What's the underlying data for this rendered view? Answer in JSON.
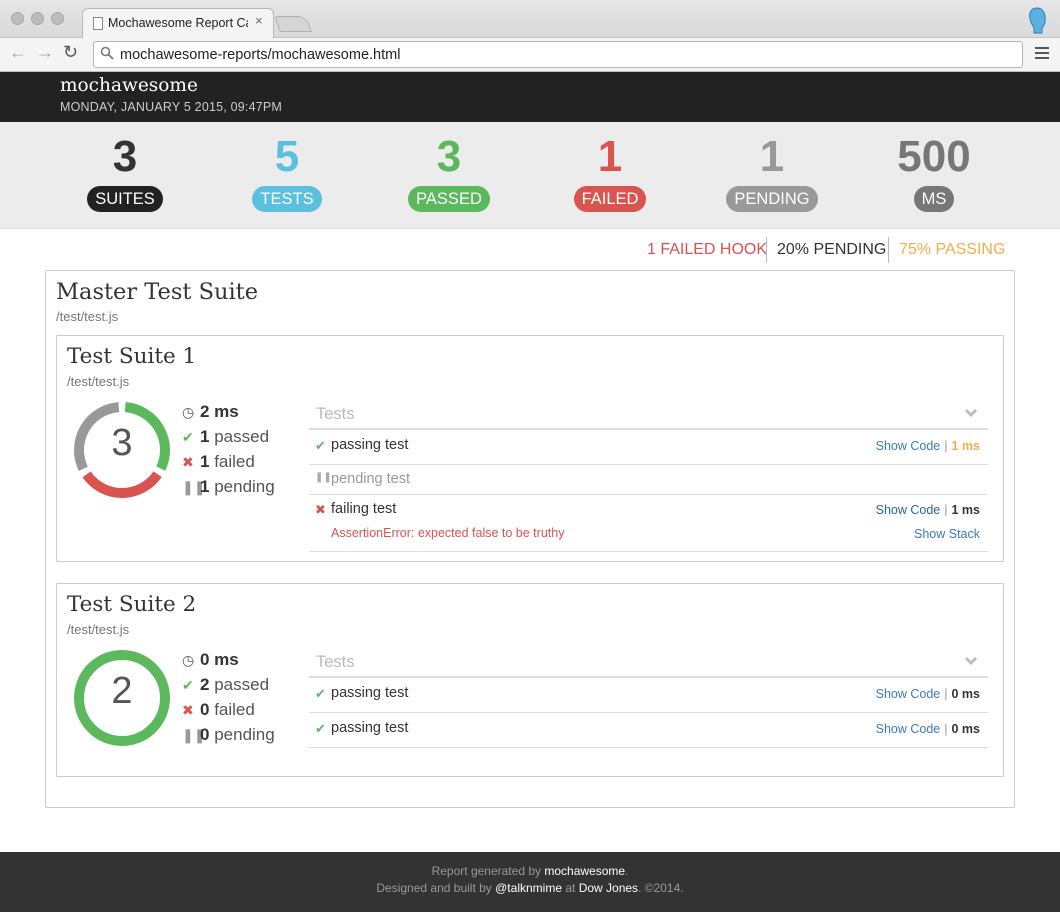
{
  "browser": {
    "tab_title": "Mochawesome Report Card",
    "tab_close": "×",
    "url": "mochawesome-reports/mochawesome.html",
    "back_glyph": "←",
    "forward_glyph": "→",
    "reload_glyph": "↻",
    "icons": {
      "doc": "document-icon",
      "search": "search-icon",
      "menu": "hamburger-menu-icon",
      "profile": "profile-icon"
    }
  },
  "header": {
    "brand": "mochawesome",
    "date": "MONDAY, JANUARY 5 2015, 09:47PM"
  },
  "summary": {
    "stats": [
      {
        "value": "3",
        "label": "SUITES",
        "color": "#222222"
      },
      {
        "value": "5",
        "label": "TESTS",
        "color": "#5bc0de"
      },
      {
        "value": "3",
        "label": "PASSED",
        "color": "#5cb85c"
      },
      {
        "value": "1",
        "label": "FAILED",
        "color": "#d9534f"
      },
      {
        "value": "1",
        "label": "PENDING",
        "color": "#999999"
      },
      {
        "value": "500",
        "label": "MS",
        "color": "#777777"
      }
    ],
    "quick": {
      "failed_hook": "1 FAILED HOOK",
      "pending": "20% PENDING",
      "passing": "75% PASSING"
    }
  },
  "master": {
    "title": "Master Test Suite",
    "path": "/test/test.js"
  },
  "suites": [
    {
      "title": "Test Suite 1",
      "path": "/test/test.js",
      "total": "3",
      "passed_fraction": 0.333,
      "failed_fraction": 0.333,
      "pending_fraction": 0.334,
      "duration": "2 ms",
      "passed": "1",
      "passed_label": "passed",
      "failed": "1",
      "failed_label": "failed",
      "pending": "1",
      "pending_label": "pending",
      "tests_label": "Tests",
      "tests": [
        {
          "name": "passing test",
          "status": "passed",
          "show_code": "Show Code",
          "pipe": "|",
          "duration": "1 ms"
        },
        {
          "name": "pending test",
          "status": "pending"
        },
        {
          "name": "failing test",
          "status": "failed",
          "show_code": "Show Code",
          "pipe": "|",
          "duration": "1 ms",
          "error": "AssertionError: expected false to be truthy",
          "show_stack": "Show Stack"
        }
      ]
    },
    {
      "title": "Test Suite 2",
      "path": "/test/test.js",
      "total": "2",
      "passed_fraction": 1.0,
      "failed_fraction": 0,
      "pending_fraction": 0,
      "duration": "0 ms",
      "passed": "2",
      "passed_label": "passed",
      "failed": "0",
      "failed_label": "failed",
      "pending": "0",
      "pending_label": "pending",
      "tests_label": "Tests",
      "tests": [
        {
          "name": "passing test",
          "status": "passed",
          "show_code": "Show Code",
          "pipe": "|",
          "duration": "0 ms"
        },
        {
          "name": "passing test",
          "status": "passed",
          "show_code": "Show Code",
          "pipe": "|",
          "duration": "0 ms"
        }
      ]
    }
  ],
  "footer": {
    "line1_prefix": "Report generated by ",
    "line1_link": "mochawesome",
    "line1_suffix": ".",
    "line2_prefix": "Designed and built by ",
    "line2_link": "@talknmime",
    "line2_mid": " at ",
    "line2_link2": "Dow Jones",
    "line2_suffix": ". ©2014."
  }
}
